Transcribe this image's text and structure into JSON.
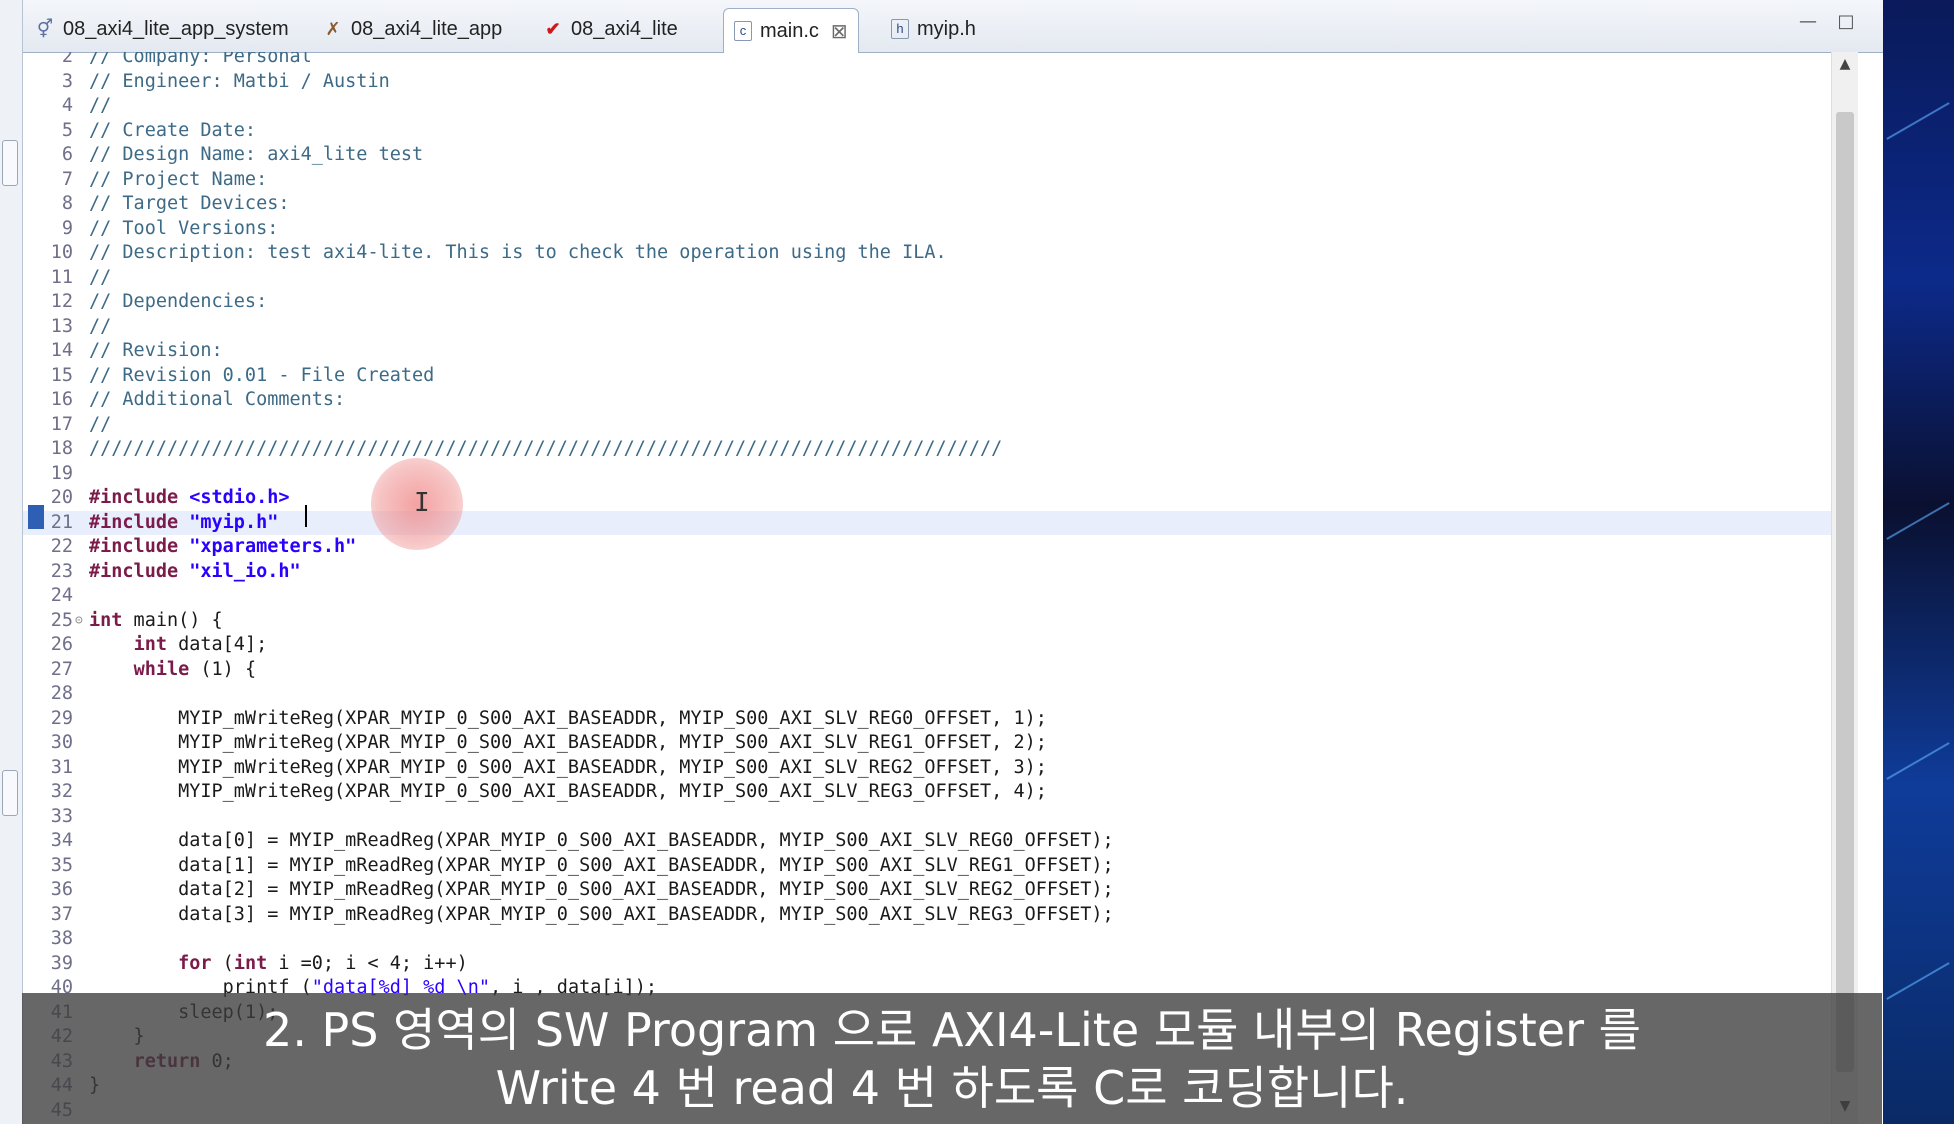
{
  "tabs": [
    {
      "label": "08_axi4_lite_app_system",
      "icon": "system-project-icon",
      "active": false
    },
    {
      "label": "08_axi4_lite_app",
      "icon": "application-project-icon",
      "active": false
    },
    {
      "label": "08_axi4_lite",
      "icon": "hardware-platform-icon",
      "active": false
    },
    {
      "label": "main.c",
      "icon": "c-file-icon",
      "active": true
    },
    {
      "label": "myip.h",
      "icon": "h-file-icon",
      "active": false
    }
  ],
  "code": {
    "current_line": 21,
    "lines": [
      {
        "n": "2",
        "text": "// Company: Personal",
        "kind": "comment"
      },
      {
        "n": "3",
        "text": "// Engineer: Matbi / Austin",
        "kind": "comment"
      },
      {
        "n": "4",
        "text": "//",
        "kind": "comment"
      },
      {
        "n": "5",
        "text": "// Create Date:",
        "kind": "comment"
      },
      {
        "n": "6",
        "text": "// Design Name: axi4_lite test",
        "kind": "comment"
      },
      {
        "n": "7",
        "text": "// Project Name:",
        "kind": "comment"
      },
      {
        "n": "8",
        "text": "// Target Devices:",
        "kind": "comment"
      },
      {
        "n": "9",
        "text": "// Tool Versions:",
        "kind": "comment"
      },
      {
        "n": "10",
        "text": "// Description: test axi4-lite. This is to check the operation using the ILA.",
        "kind": "comment"
      },
      {
        "n": "11",
        "text": "//",
        "kind": "comment"
      },
      {
        "n": "12",
        "text": "// Dependencies:",
        "kind": "comment"
      },
      {
        "n": "13",
        "text": "//",
        "kind": "comment"
      },
      {
        "n": "14",
        "text": "// Revision:",
        "kind": "comment"
      },
      {
        "n": "15",
        "text": "// Revision 0.01 - File Created",
        "kind": "comment"
      },
      {
        "n": "16",
        "text": "// Additional Comments:",
        "kind": "comment"
      },
      {
        "n": "17",
        "text": "//",
        "kind": "comment"
      },
      {
        "n": "18",
        "text": "//////////////////////////////////////////////////////////////////////////////////",
        "kind": "comment"
      },
      {
        "n": "19",
        "text": "",
        "kind": "text"
      },
      {
        "n": "20",
        "text": "#include <stdio.h>",
        "kind": "include"
      },
      {
        "n": "21",
        "text": "#include \"myip.h\"",
        "kind": "include"
      },
      {
        "n": "22",
        "text": "#include \"xparameters.h\"",
        "kind": "include"
      },
      {
        "n": "23",
        "text": "#include \"xil_io.h\"",
        "kind": "include"
      },
      {
        "n": "24",
        "text": "",
        "kind": "text"
      },
      {
        "n": "25",
        "text": "int main() {",
        "kind": "code",
        "fold": true
      },
      {
        "n": "26",
        "text": "    int data[4];",
        "kind": "code"
      },
      {
        "n": "27",
        "text": "    while (1) {",
        "kind": "code"
      },
      {
        "n": "28",
        "text": "",
        "kind": "text"
      },
      {
        "n": "29",
        "text": "        MYIP_mWriteReg(XPAR_MYIP_0_S00_AXI_BASEADDR, MYIP_S00_AXI_SLV_REG0_OFFSET, 1);",
        "kind": "code"
      },
      {
        "n": "30",
        "text": "        MYIP_mWriteReg(XPAR_MYIP_0_S00_AXI_BASEADDR, MYIP_S00_AXI_SLV_REG1_OFFSET, 2);",
        "kind": "code"
      },
      {
        "n": "31",
        "text": "        MYIP_mWriteReg(XPAR_MYIP_0_S00_AXI_BASEADDR, MYIP_S00_AXI_SLV_REG2_OFFSET, 3);",
        "kind": "code"
      },
      {
        "n": "32",
        "text": "        MYIP_mWriteReg(XPAR_MYIP_0_S00_AXI_BASEADDR, MYIP_S00_AXI_SLV_REG3_OFFSET, 4);",
        "kind": "code"
      },
      {
        "n": "33",
        "text": "",
        "kind": "text"
      },
      {
        "n": "34",
        "text": "        data[0] = MYIP_mReadReg(XPAR_MYIP_0_S00_AXI_BASEADDR, MYIP_S00_AXI_SLV_REG0_OFFSET);",
        "kind": "code"
      },
      {
        "n": "35",
        "text": "        data[1] = MYIP_mReadReg(XPAR_MYIP_0_S00_AXI_BASEADDR, MYIP_S00_AXI_SLV_REG1_OFFSET);",
        "kind": "code"
      },
      {
        "n": "36",
        "text": "        data[2] = MYIP_mReadReg(XPAR_MYIP_0_S00_AXI_BASEADDR, MYIP_S00_AXI_SLV_REG2_OFFSET);",
        "kind": "code"
      },
      {
        "n": "37",
        "text": "        data[3] = MYIP_mReadReg(XPAR_MYIP_0_S00_AXI_BASEADDR, MYIP_S00_AXI_SLV_REG3_OFFSET);",
        "kind": "code"
      },
      {
        "n": "38",
        "text": "",
        "kind": "text"
      },
      {
        "n": "39",
        "text": "        for (int i =0; i < 4; i++)",
        "kind": "code"
      },
      {
        "n": "40",
        "text": "            printf (\"data[%d] %d \\n\", i , data[i]);",
        "kind": "code"
      },
      {
        "n": "41",
        "text": "        sleep(1);",
        "kind": "code"
      },
      {
        "n": "42",
        "text": "    }",
        "kind": "code"
      },
      {
        "n": "43",
        "text": "    return 0;",
        "kind": "code"
      },
      {
        "n": "44",
        "text": "}",
        "kind": "code"
      },
      {
        "n": "45",
        "text": "",
        "kind": "text"
      }
    ]
  },
  "subtitle": {
    "line1": "2. PS 영역의 SW Program 으로 AXI4-Lite 모듈 내부의 Register 를",
    "line2": "Write 4 번 read 4 번 하도록 C로 코딩합니다."
  },
  "colors": {
    "comment": "#3d6a86",
    "preprocessor": "#7a1b4a",
    "string": "#2a00ff",
    "current_line": "#e8eefb"
  }
}
